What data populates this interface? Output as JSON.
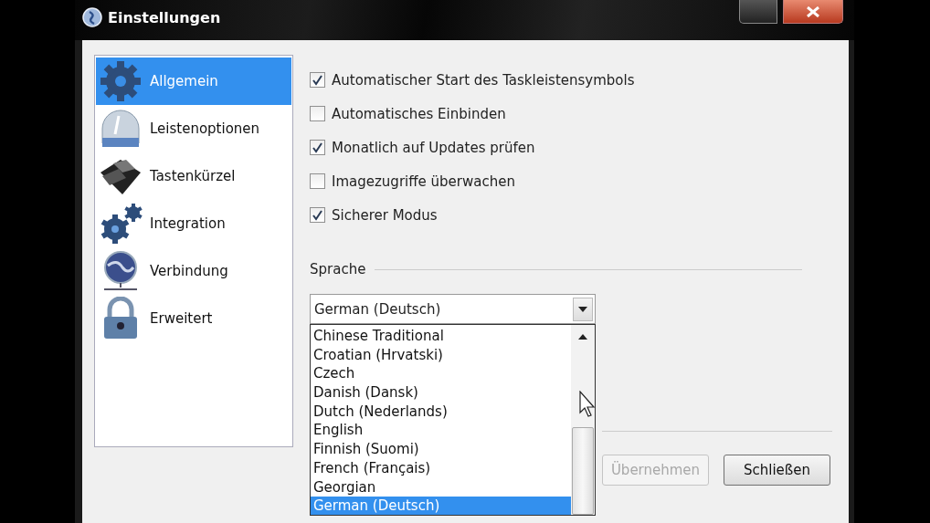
{
  "window": {
    "title": "Einstellungen"
  },
  "sidebar": {
    "items": [
      {
        "label": "Allgemein",
        "selected": true
      },
      {
        "label": "Leistenoptionen",
        "selected": false
      },
      {
        "label": "Tastenkürzel",
        "selected": false
      },
      {
        "label": "Integration",
        "selected": false
      },
      {
        "label": "Verbindung",
        "selected": false
      },
      {
        "label": "Erweitert",
        "selected": false
      }
    ]
  },
  "options": [
    {
      "label": "Automatischer Start des Taskleistensymbols",
      "checked": true
    },
    {
      "label": "Automatisches Einbinden",
      "checked": false
    },
    {
      "label": "Monatlich auf Updates prüfen",
      "checked": true
    },
    {
      "label": "Imagezugriffe überwachen",
      "checked": false
    },
    {
      "label": "Sicherer Modus",
      "checked": true
    }
  ],
  "language": {
    "label": "Sprache",
    "value": "German (Deutsch)",
    "expanded": true,
    "items": [
      {
        "label": "Chinese Traditional",
        "selected": false
      },
      {
        "label": "Croatian (Hrvatski)",
        "selected": false
      },
      {
        "label": "Czech",
        "selected": false
      },
      {
        "label": "Danish (Dansk)",
        "selected": false
      },
      {
        "label": "Dutch (Nederlands)",
        "selected": false
      },
      {
        "label": "English",
        "selected": false
      },
      {
        "label": "Finnish (Suomi)",
        "selected": false
      },
      {
        "label": "French (Français)",
        "selected": false
      },
      {
        "label": "Georgian",
        "selected": false
      },
      {
        "label": "German (Deutsch)",
        "selected": true
      }
    ]
  },
  "buttons": [
    {
      "label": "Übernehmen",
      "disabled": true
    },
    {
      "label": "Schließen",
      "disabled": false
    }
  ]
}
